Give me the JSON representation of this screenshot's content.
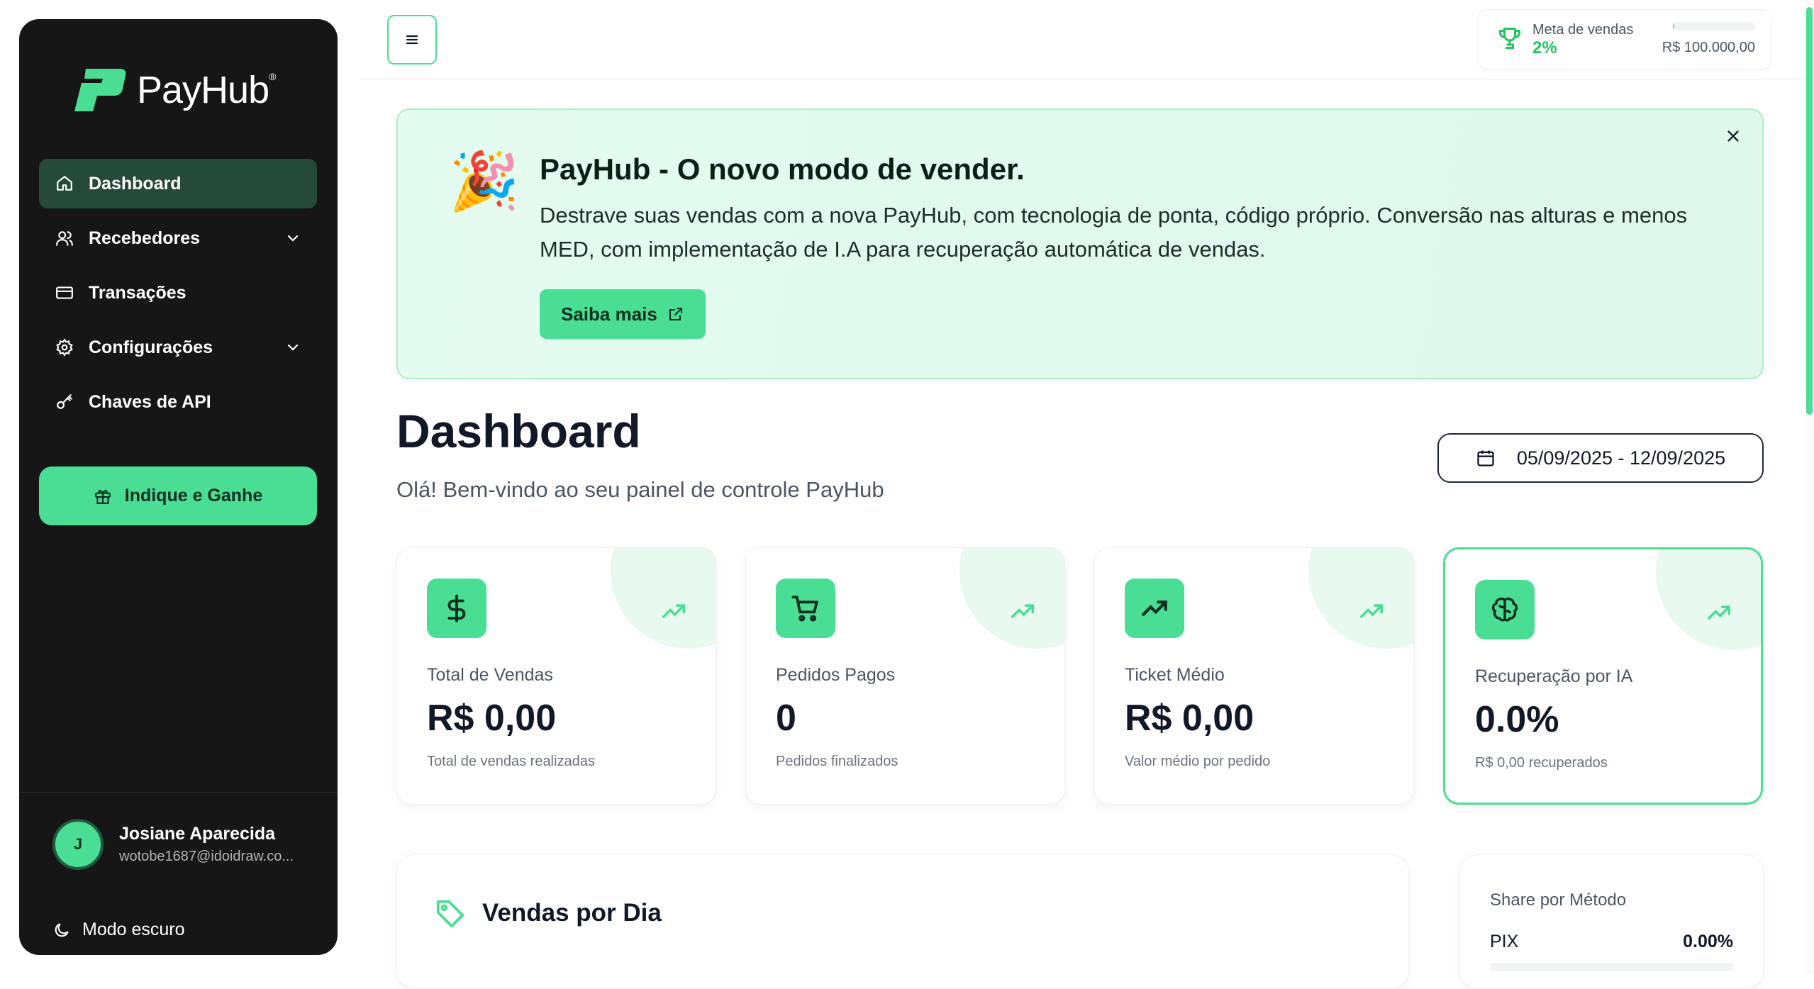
{
  "brand": {
    "name": "PayHub",
    "registered": "®",
    "accent": "#4ade94"
  },
  "sidebar": {
    "items": [
      {
        "label": "Dashboard",
        "icon": "home-icon",
        "active": true
      },
      {
        "label": "Recebedores",
        "icon": "users-icon",
        "has_submenu": true
      },
      {
        "label": "Transações",
        "icon": "card-icon"
      },
      {
        "label": "Configurações",
        "icon": "gear-icon",
        "has_submenu": true
      },
      {
        "label": "Chaves de API",
        "icon": "key-icon"
      }
    ],
    "cta_label": "Indique e Ganhe",
    "user": {
      "initial": "J",
      "name": "Josiane Aparecida",
      "email": "wotobe1687@idoidraw.co..."
    },
    "dark_mode_label": "Modo escuro"
  },
  "topbar": {
    "goal": {
      "title": "Meta de vendas",
      "percent_label": "2%",
      "progress": 0.02,
      "target": "R$ 100.000,00"
    }
  },
  "banner": {
    "title": "PayHub - O novo modo de vender.",
    "text": "Destrave suas vendas com a nova PayHub, com tecnologia de ponta, código próprio. Conversão nas alturas e menos MED, com implementação de I.A para recuperação automática de vendas.",
    "button_label": "Saiba mais",
    "emoji": "🎉"
  },
  "page": {
    "title": "Dashboard",
    "subtitle": "Olá! Bem-vindo ao seu painel de controle PayHub",
    "date_range": "05/09/2025 - 12/09/2025"
  },
  "stats": [
    {
      "label": "Total de Vendas",
      "value": "R$ 0,00",
      "sub": "Total de vendas realizadas",
      "icon": "dollar-icon"
    },
    {
      "label": "Pedidos Pagos",
      "value": "0",
      "sub": "Pedidos finalizados",
      "icon": "cart-icon"
    },
    {
      "label": "Ticket Médio",
      "value": "R$ 0,00",
      "sub": "Valor médio por pedido",
      "icon": "trend-up-icon"
    },
    {
      "label": "Recuperação por IA",
      "value": "0.0%",
      "sub": "R$ 0,00 recuperados",
      "icon": "brain-icon"
    }
  ],
  "vendas": {
    "title": "Vendas por Dia"
  },
  "share": {
    "title": "Share por Método",
    "rows": [
      {
        "name": "PIX",
        "value": "0.00%"
      }
    ]
  }
}
